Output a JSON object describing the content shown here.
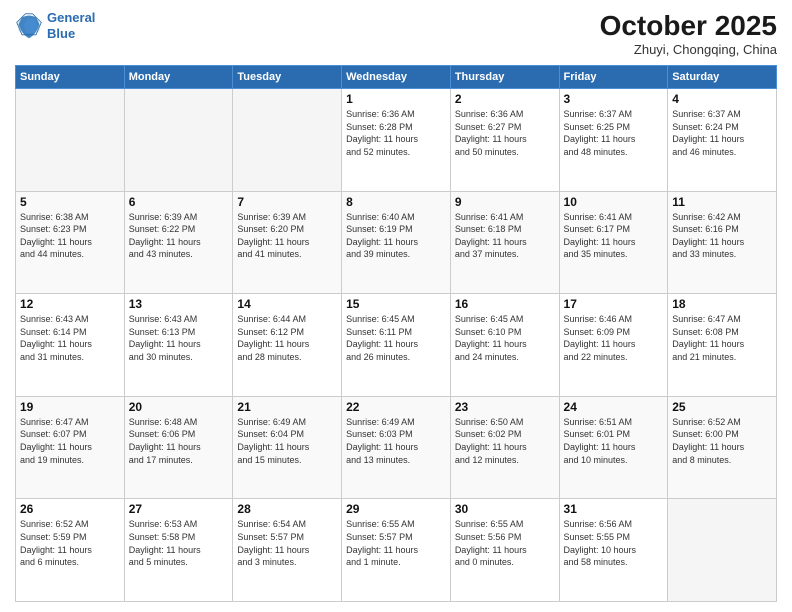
{
  "header": {
    "logo_line1": "General",
    "logo_line2": "Blue",
    "month": "October 2025",
    "location": "Zhuyi, Chongqing, China"
  },
  "weekdays": [
    "Sunday",
    "Monday",
    "Tuesday",
    "Wednesday",
    "Thursday",
    "Friday",
    "Saturday"
  ],
  "weeks": [
    [
      {
        "day": "",
        "info": ""
      },
      {
        "day": "",
        "info": ""
      },
      {
        "day": "",
        "info": ""
      },
      {
        "day": "1",
        "info": "Sunrise: 6:36 AM\nSunset: 6:28 PM\nDaylight: 11 hours\nand 52 minutes."
      },
      {
        "day": "2",
        "info": "Sunrise: 6:36 AM\nSunset: 6:27 PM\nDaylight: 11 hours\nand 50 minutes."
      },
      {
        "day": "3",
        "info": "Sunrise: 6:37 AM\nSunset: 6:25 PM\nDaylight: 11 hours\nand 48 minutes."
      },
      {
        "day": "4",
        "info": "Sunrise: 6:37 AM\nSunset: 6:24 PM\nDaylight: 11 hours\nand 46 minutes."
      }
    ],
    [
      {
        "day": "5",
        "info": "Sunrise: 6:38 AM\nSunset: 6:23 PM\nDaylight: 11 hours\nand 44 minutes."
      },
      {
        "day": "6",
        "info": "Sunrise: 6:39 AM\nSunset: 6:22 PM\nDaylight: 11 hours\nand 43 minutes."
      },
      {
        "day": "7",
        "info": "Sunrise: 6:39 AM\nSunset: 6:20 PM\nDaylight: 11 hours\nand 41 minutes."
      },
      {
        "day": "8",
        "info": "Sunrise: 6:40 AM\nSunset: 6:19 PM\nDaylight: 11 hours\nand 39 minutes."
      },
      {
        "day": "9",
        "info": "Sunrise: 6:41 AM\nSunset: 6:18 PM\nDaylight: 11 hours\nand 37 minutes."
      },
      {
        "day": "10",
        "info": "Sunrise: 6:41 AM\nSunset: 6:17 PM\nDaylight: 11 hours\nand 35 minutes."
      },
      {
        "day": "11",
        "info": "Sunrise: 6:42 AM\nSunset: 6:16 PM\nDaylight: 11 hours\nand 33 minutes."
      }
    ],
    [
      {
        "day": "12",
        "info": "Sunrise: 6:43 AM\nSunset: 6:14 PM\nDaylight: 11 hours\nand 31 minutes."
      },
      {
        "day": "13",
        "info": "Sunrise: 6:43 AM\nSunset: 6:13 PM\nDaylight: 11 hours\nand 30 minutes."
      },
      {
        "day": "14",
        "info": "Sunrise: 6:44 AM\nSunset: 6:12 PM\nDaylight: 11 hours\nand 28 minutes."
      },
      {
        "day": "15",
        "info": "Sunrise: 6:45 AM\nSunset: 6:11 PM\nDaylight: 11 hours\nand 26 minutes."
      },
      {
        "day": "16",
        "info": "Sunrise: 6:45 AM\nSunset: 6:10 PM\nDaylight: 11 hours\nand 24 minutes."
      },
      {
        "day": "17",
        "info": "Sunrise: 6:46 AM\nSunset: 6:09 PM\nDaylight: 11 hours\nand 22 minutes."
      },
      {
        "day": "18",
        "info": "Sunrise: 6:47 AM\nSunset: 6:08 PM\nDaylight: 11 hours\nand 21 minutes."
      }
    ],
    [
      {
        "day": "19",
        "info": "Sunrise: 6:47 AM\nSunset: 6:07 PM\nDaylight: 11 hours\nand 19 minutes."
      },
      {
        "day": "20",
        "info": "Sunrise: 6:48 AM\nSunset: 6:06 PM\nDaylight: 11 hours\nand 17 minutes."
      },
      {
        "day": "21",
        "info": "Sunrise: 6:49 AM\nSunset: 6:04 PM\nDaylight: 11 hours\nand 15 minutes."
      },
      {
        "day": "22",
        "info": "Sunrise: 6:49 AM\nSunset: 6:03 PM\nDaylight: 11 hours\nand 13 minutes."
      },
      {
        "day": "23",
        "info": "Sunrise: 6:50 AM\nSunset: 6:02 PM\nDaylight: 11 hours\nand 12 minutes."
      },
      {
        "day": "24",
        "info": "Sunrise: 6:51 AM\nSunset: 6:01 PM\nDaylight: 11 hours\nand 10 minutes."
      },
      {
        "day": "25",
        "info": "Sunrise: 6:52 AM\nSunset: 6:00 PM\nDaylight: 11 hours\nand 8 minutes."
      }
    ],
    [
      {
        "day": "26",
        "info": "Sunrise: 6:52 AM\nSunset: 5:59 PM\nDaylight: 11 hours\nand 6 minutes."
      },
      {
        "day": "27",
        "info": "Sunrise: 6:53 AM\nSunset: 5:58 PM\nDaylight: 11 hours\nand 5 minutes."
      },
      {
        "day": "28",
        "info": "Sunrise: 6:54 AM\nSunset: 5:57 PM\nDaylight: 11 hours\nand 3 minutes."
      },
      {
        "day": "29",
        "info": "Sunrise: 6:55 AM\nSunset: 5:57 PM\nDaylight: 11 hours\nand 1 minute."
      },
      {
        "day": "30",
        "info": "Sunrise: 6:55 AM\nSunset: 5:56 PM\nDaylight: 11 hours\nand 0 minutes."
      },
      {
        "day": "31",
        "info": "Sunrise: 6:56 AM\nSunset: 5:55 PM\nDaylight: 10 hours\nand 58 minutes."
      },
      {
        "day": "",
        "info": ""
      }
    ]
  ]
}
